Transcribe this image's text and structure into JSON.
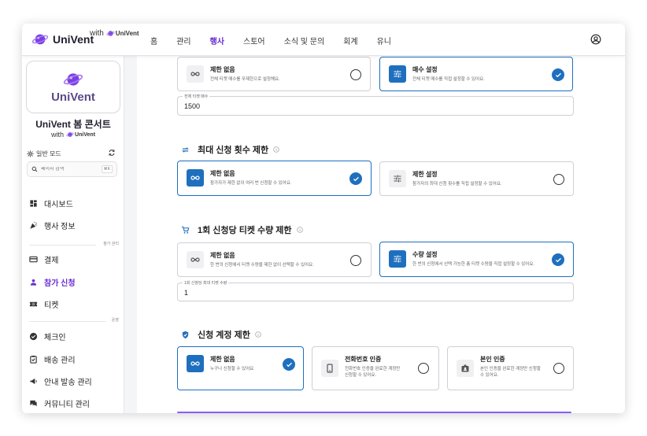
{
  "app": {
    "brand": "UniVent",
    "with_label": "with",
    "with_brand": "UniVent"
  },
  "nav": {
    "items": [
      "홈",
      "관리",
      "행사",
      "스토어",
      "소식 및 문의",
      "회계",
      "유니"
    ],
    "active": "행사"
  },
  "sidebar": {
    "card_brand": "UniVent",
    "event_title": "UniVent 봄 콘서트",
    "with_label": "with",
    "with_brand": "UniVent",
    "mode_label": "일반 모드",
    "search_placeholder": "페이지 검색",
    "search_shortcut": "⌘K",
    "group_participation": "참가 관리",
    "group_operation": "운영",
    "items": {
      "dashboard": "대시보드",
      "event_info": "행사 정보",
      "payment": "결제",
      "registration": "참가 신청",
      "ticket": "티켓",
      "checkin": "체크인",
      "delivery": "배송 관리",
      "notice_send": "안내 발송 관리",
      "community": "커뮤니티 관리"
    },
    "active_item": "참가 신청"
  },
  "main": {
    "total_limit": {
      "no_limit_title": "제한 없음",
      "no_limit_desc": "전체 티켓 매수를 무제한으로 설정해요.",
      "set_title": "매수 설정",
      "set_desc": "전체 티켓 매수를 직접 설정할 수 있어요.",
      "field_label": "전체 티켓 매수",
      "field_value": "1500",
      "selected": "set"
    },
    "max_apply": {
      "title": "최대 신청 횟수 제한",
      "no_limit_title": "제한 없음",
      "no_limit_desc": "참가자가 제한 없이 여러 번 신청할 수 있어요.",
      "set_title": "제한 설정",
      "set_desc": "참가자의 최대 신청 횟수를 직접 설정할 수 있어요.",
      "selected": "no_limit"
    },
    "per_apply": {
      "title": "1회 신청당 티켓 수량 제한",
      "no_limit_title": "제한 없음",
      "no_limit_desc": "한 번의 신청에서 티켓 수량을 제한 없이 선택할 수 있어요.",
      "set_title": "수량 설정",
      "set_desc": "한 번의 신청에서 선택 가능한 총 티켓 수량을 직접 설정할 수 있어요.",
      "field_label": "1회 신청당 최대 티켓 수량",
      "field_value": "1",
      "selected": "set"
    },
    "account_limit": {
      "title": "신청 계정 제한",
      "no_limit_title": "제한 없음",
      "no_limit_desc": "누구나 신청할 수 있어요.",
      "phone_title": "전화번호 인증",
      "phone_desc_1": "전화번호 인증을 완료한 계정만",
      "phone_desc_2": "신청할 수 있어요.",
      "id_title": "본인 인증",
      "id_desc_1": "본인 인증을 완료한 계정만 신청할",
      "id_desc_2": "수 있어요.",
      "selected": "no_limit"
    }
  },
  "colors": {
    "accent": "#6a2dd1",
    "selected_blue": "#1f6fbf"
  }
}
